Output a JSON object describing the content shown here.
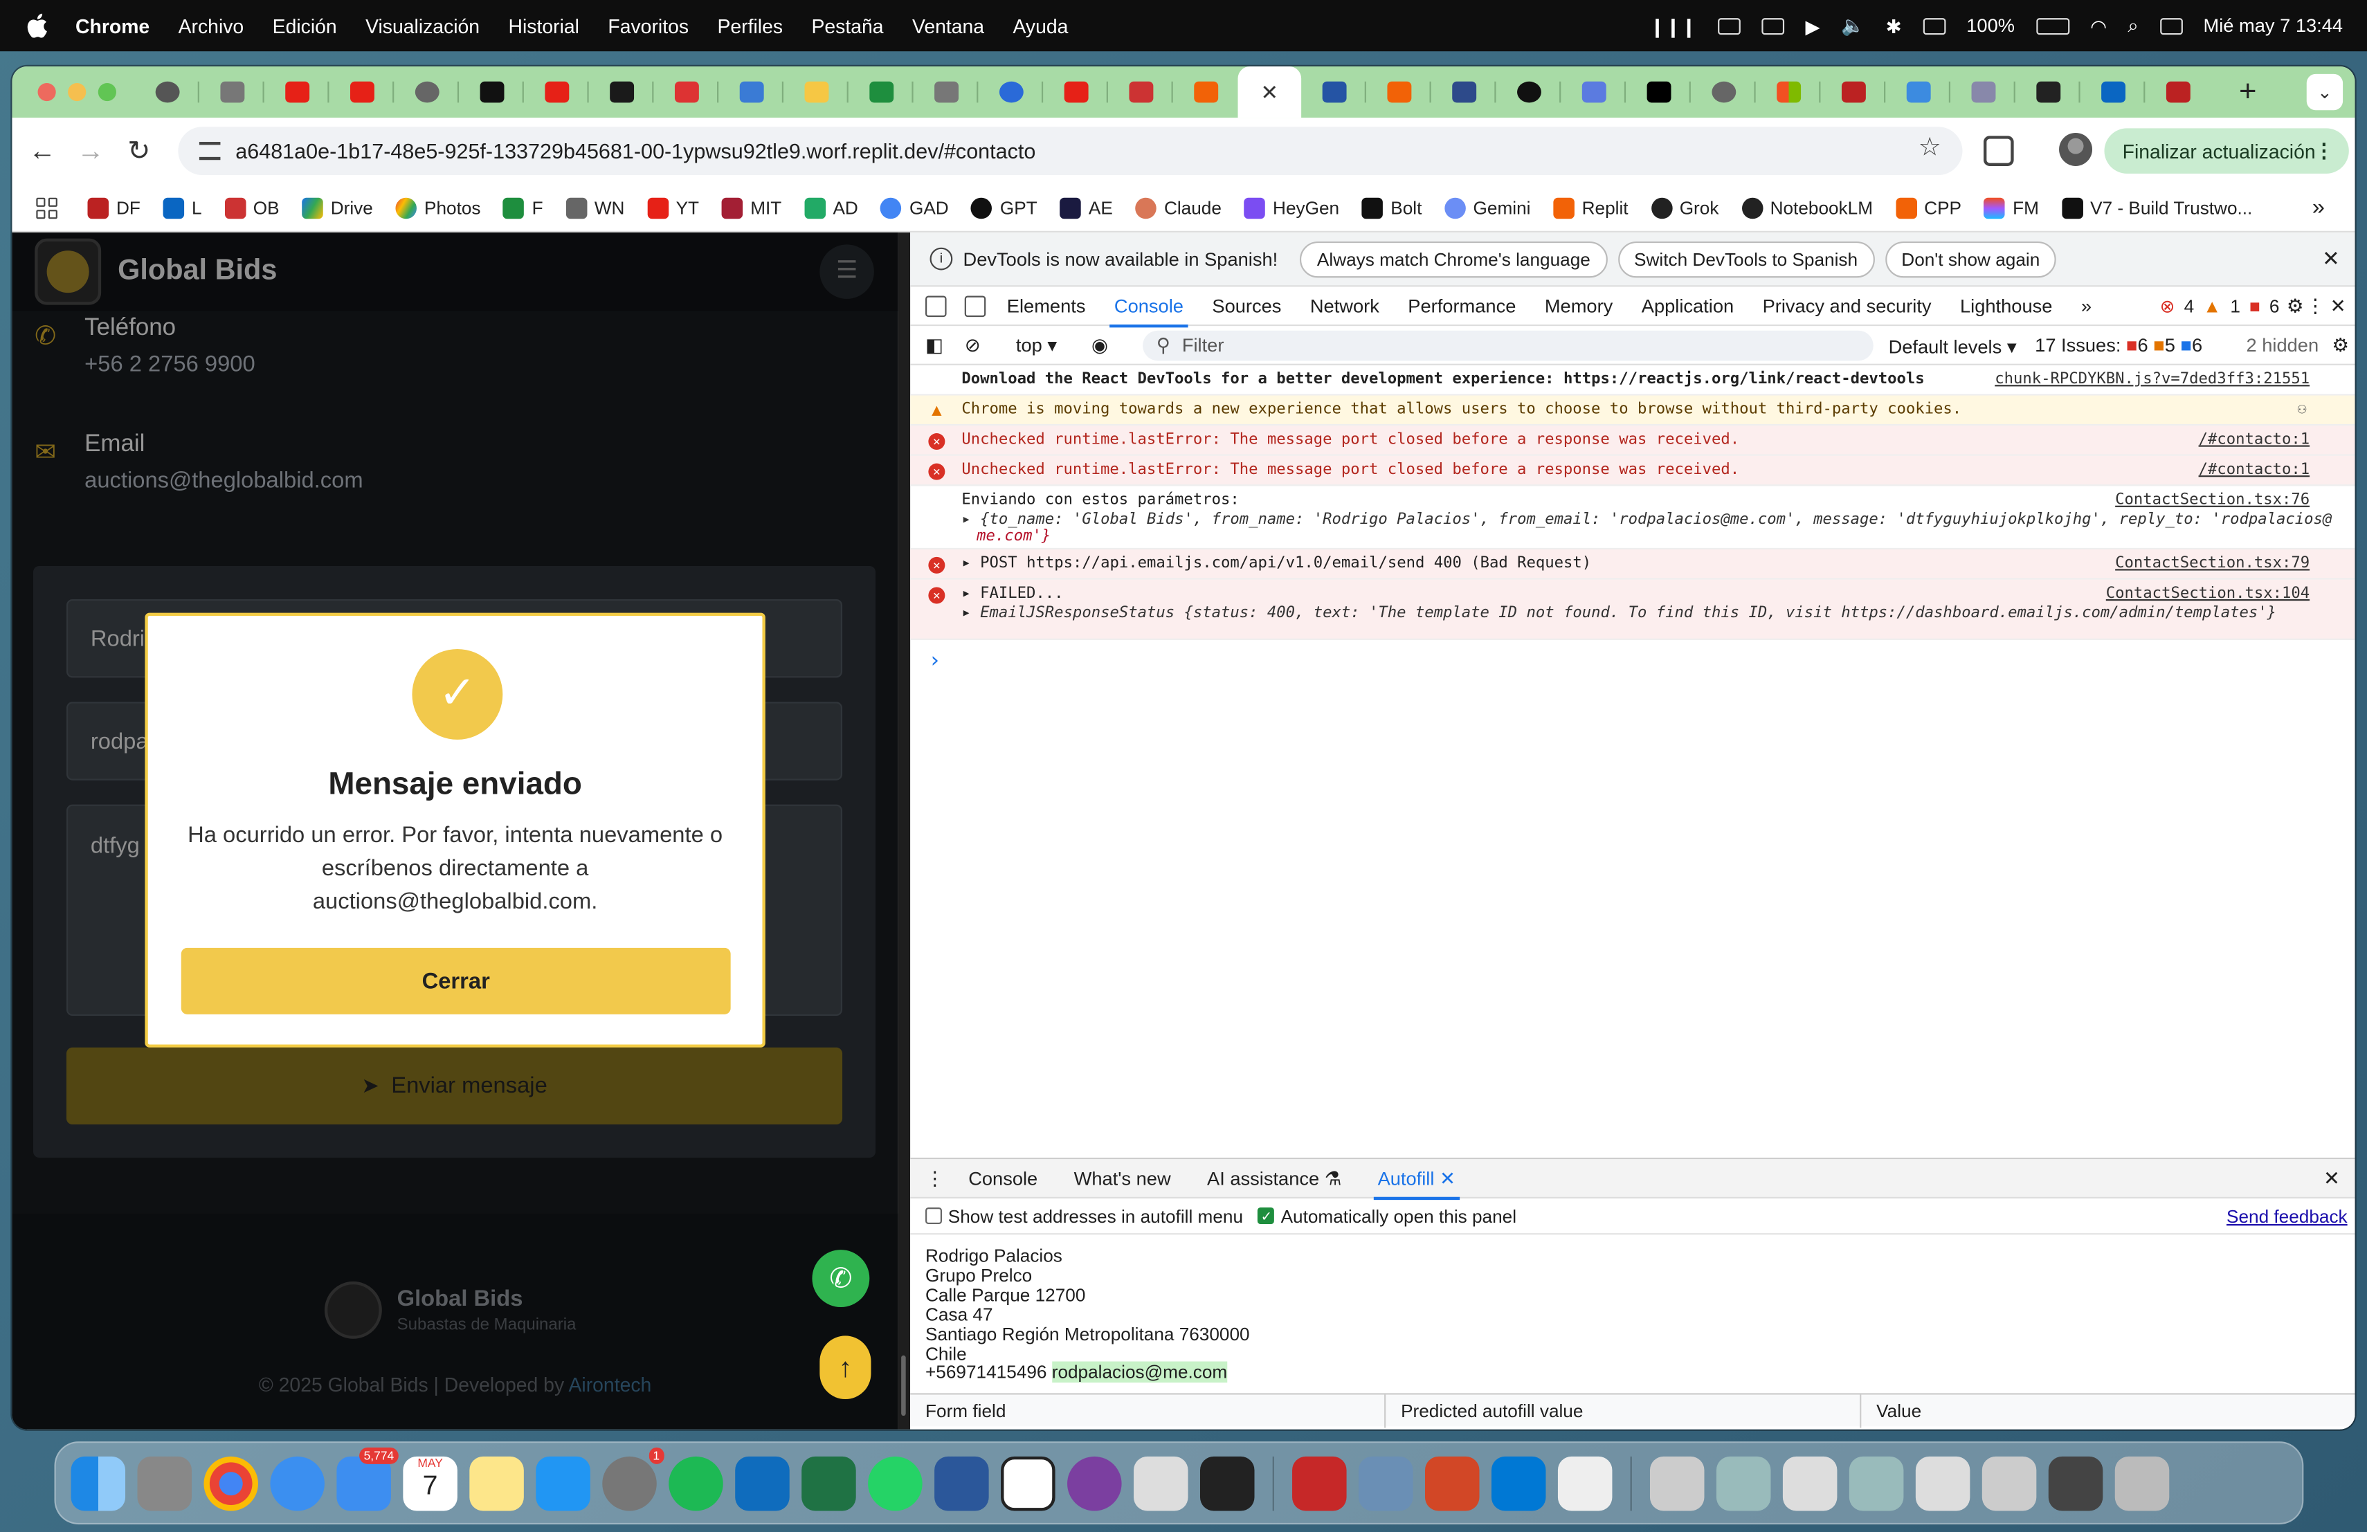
{
  "menubar": {
    "app": "Chrome",
    "items": [
      "Archivo",
      "Edición",
      "Visualización",
      "Historial",
      "Favoritos",
      "Perfiles",
      "Pestaña",
      "Ventana",
      "Ayuda"
    ],
    "battery": "100%",
    "clock": "Mié may 7  13:44"
  },
  "browser": {
    "url": "a6481a0e-1b17-48e5-925f-133729b45681-00-1ypwsu92tle9.worf.replit.dev/#contacto",
    "update_label": "Finalizar actualización",
    "bookmarks": [
      "DF",
      "L",
      "OB",
      "Drive",
      "Photos",
      "F",
      "WN",
      "YT",
      "MIT",
      "AD",
      "GAD",
      "GPT",
      "AE",
      "Claude",
      "HeyGen",
      "Bolt",
      "Gemini",
      "Replit",
      "Grok",
      "NotebookLM",
      "CPP",
      "FM",
      "V7 - Build Trustwo..."
    ]
  },
  "site": {
    "brand": "Global Bids",
    "phone_label": "Teléfono",
    "phone_value": "+56 2 2756 9900",
    "email_label": "Email",
    "email_value": "auctions@theglobalbid.com",
    "field_name": "Rodri",
    "field_email": "rodpa",
    "field_message": "dtfyg",
    "send_label": "Enviar mensaje",
    "footer_brand": "Global Bids",
    "footer_sub": "Subastas de Maquinaria",
    "copyright": "© 2025 Global Bids  |  Developed by",
    "developer": "Airontech"
  },
  "modal": {
    "title": "Mensaje enviado",
    "text": "Ha ocurrido un error. Por favor, intenta nuevamente o escríbenos directamente a auctions@theglobalbid.com.",
    "button": "Cerrar"
  },
  "devtools": {
    "info_msg": "DevTools is now available in Spanish!",
    "info_btn1": "Always match Chrome's language",
    "info_btn2": "Switch DevTools to Spanish",
    "info_btn3": "Don't show again",
    "tabs": [
      "Elements",
      "Console",
      "Sources",
      "Network",
      "Performance",
      "Memory",
      "Application",
      "Privacy and security",
      "Lighthouse"
    ],
    "err_count": "4",
    "warn_count": "1",
    "info_count": "6",
    "context": "top",
    "filter_placeholder": "Filter",
    "levels": "Default levels",
    "issues": "17 Issues:",
    "issues_e": "6",
    "issues_w": "5",
    "issues_i": "6",
    "hidden": "2 hidden",
    "log": {
      "r1_text": "Download the React DevTools for a better development experience:",
      "r1_link": "https://reactjs.org/link/react-devtools",
      "r1_src": "chunk-RPCDYKBN.js?v=7ded3ff3:21551",
      "r2_text": "Chrome is moving towards a new experience that allows users to choose to browse without third-party cookies.",
      "r3_text": "Unchecked runtime.lastError: The message port closed before a response was received.",
      "r3_src": "/#contacto:1",
      "r4_text": "Unchecked runtime.lastError: The message port closed before a response was received.",
      "r4_src": "/#contacto:1",
      "r5_text": "Enviando con estos parámetros:",
      "r5_src": "ContactSection.tsx:76",
      "r5_obj_a": "{to_name: 'Global Bids', from_name: 'Rodrigo Palacios', from_email: 'rodpalacios@me.com', message: 'dtfyguyhiujokplkojhg', reply_to: 'rodpalacios@",
      "r5_obj_b": "me.com'}",
      "r6_method": "POST",
      "r6_link": "https://api.emailjs.com/api/v1.0/email/send",
      "r6_status": "400 (Bad Request)",
      "r6_src": "ContactSection.tsx:79",
      "r7_text": "FAILED...",
      "r7_src": "ContactSection.tsx:104",
      "r7_obj": "EmailJSResponseStatus {status: 400, text: 'The template ID not found. To find this ID, visit https://dashboard.emailjs.com/admin/templates'}"
    },
    "drawer_tabs": [
      "Console",
      "What's new",
      "AI assistance",
      "Autofill"
    ],
    "autofill": {
      "opt1": "Show test addresses in autofill menu",
      "opt2": "Automatically open this panel",
      "feedback": "Send feedback",
      "lines": [
        "Rodrigo Palacios",
        "Grupo Prelco",
        "Calle Parque 12700",
        "Casa 47",
        "Santiago Región Metropolitana 7630000",
        "Chile"
      ],
      "phone": "+56971415496",
      "email": "rodpalacios@me.com",
      "col1": "Form field",
      "col2": "Predicted autofill value",
      "col3": "Value"
    }
  },
  "dock": {
    "mail_badge": "5,774",
    "settings_badge": "1",
    "calendar_month": "MAY",
    "calendar_day": "7"
  }
}
